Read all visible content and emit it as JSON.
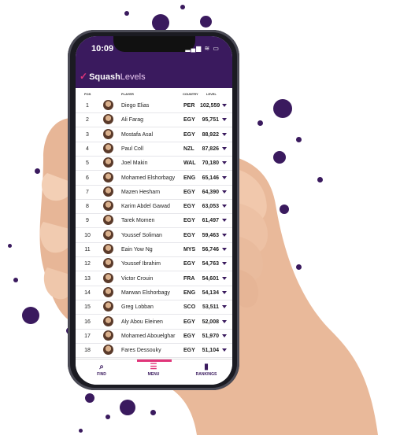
{
  "status": {
    "time": "10:09",
    "signal": "▂▄▆ ≋ ▭"
  },
  "brand": {
    "name_a": "Squash",
    "name_b": "Levels"
  },
  "table": {
    "headers": {
      "pos": "POS",
      "player": "PLAYER",
      "country": "COUNTRY",
      "level": "LEVEL"
    },
    "rows": [
      {
        "pos": "1",
        "player": "Diego Elias",
        "country": "PER",
        "level": "102,559"
      },
      {
        "pos": "2",
        "player": "Ali Farag",
        "country": "EGY",
        "level": "95,751"
      },
      {
        "pos": "3",
        "player": "Mostafa Asal",
        "country": "EGY",
        "level": "88,922"
      },
      {
        "pos": "4",
        "player": "Paul Coll",
        "country": "NZL",
        "level": "87,826"
      },
      {
        "pos": "5",
        "player": "Joel Makin",
        "country": "WAL",
        "level": "70,180"
      },
      {
        "pos": "6",
        "player": "Mohamed Elshorbagy",
        "country": "ENG",
        "level": "65,146"
      },
      {
        "pos": "7",
        "player": "Mazen Hesham",
        "country": "EGY",
        "level": "64,390"
      },
      {
        "pos": "8",
        "player": "Karim Abdel Gawad",
        "country": "EGY",
        "level": "63,053"
      },
      {
        "pos": "9",
        "player": "Tarek Momen",
        "country": "EGY",
        "level": "61,497"
      },
      {
        "pos": "10",
        "player": "Youssef Soliman",
        "country": "EGY",
        "level": "59,463"
      },
      {
        "pos": "11",
        "player": "Eain Yow Ng",
        "country": "MYS",
        "level": "56,746"
      },
      {
        "pos": "12",
        "player": "Youssef Ibrahim",
        "country": "EGY",
        "level": "54,763"
      },
      {
        "pos": "13",
        "player": "Victor Crouin",
        "country": "FRA",
        "level": "54,601"
      },
      {
        "pos": "14",
        "player": "Marwan Elshorbagy",
        "country": "ENG",
        "level": "54,134"
      },
      {
        "pos": "15",
        "player": "Greg Lobban",
        "country": "SCO",
        "level": "53,511"
      },
      {
        "pos": "16",
        "player": "Aly Abou Eleinen",
        "country": "EGY",
        "level": "52,008"
      },
      {
        "pos": "17",
        "player": "Mohamed Abouelghar",
        "country": "EGY",
        "level": "51,970"
      },
      {
        "pos": "18",
        "player": "Fares Dessouky",
        "country": "EGY",
        "level": "51,104"
      }
    ]
  },
  "nav": {
    "find": {
      "label": "FIND",
      "icon": "search-icon"
    },
    "menu": {
      "label": "MENU",
      "icon": "menu-icon"
    },
    "rankings": {
      "label": "RANKINGS",
      "icon": "bar-chart-icon"
    }
  },
  "colors": {
    "brand_purple": "#3a1a5e",
    "accent_pink": "#e0357a"
  }
}
